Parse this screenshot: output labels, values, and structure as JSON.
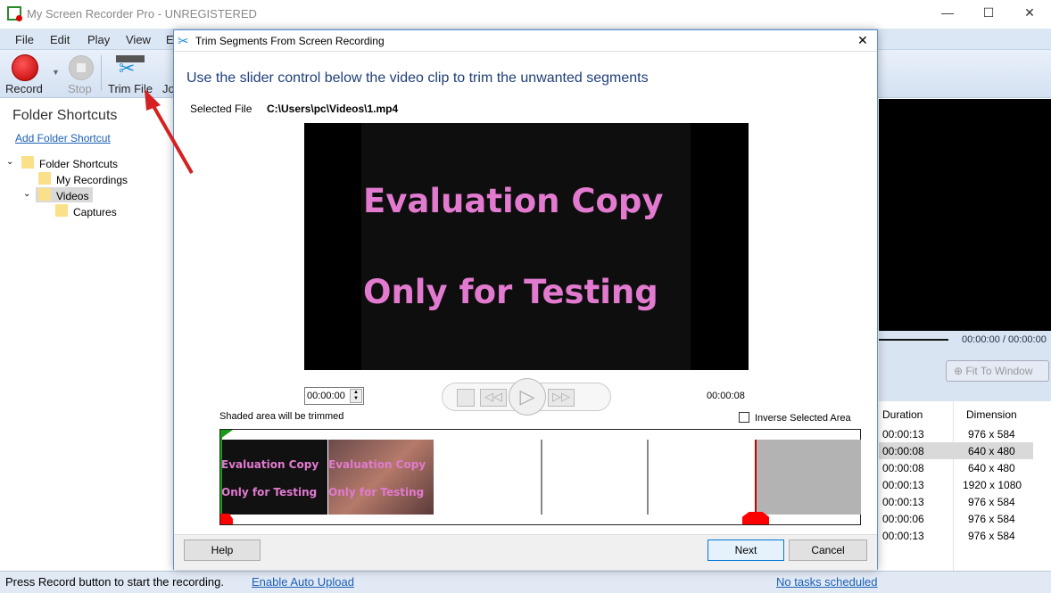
{
  "app": {
    "title": "My Screen Recorder Pro - UNREGISTERED",
    "menu": [
      "File",
      "Edit",
      "Play",
      "View",
      "E"
    ],
    "toolbar": {
      "record": "Record",
      "stop": "Stop",
      "trim": "Trim File",
      "join": "Jo"
    }
  },
  "left": {
    "heading": "Folder Shortcuts",
    "add_link": "Add Folder Shortcut",
    "tree": [
      "Folder Shortcuts",
      "My Recordings",
      "Videos",
      "Captures"
    ]
  },
  "right": {
    "time": "00:00:00 / 00:00:00",
    "fit": "Fit To Window",
    "columns": [
      "Duration",
      "Dimension"
    ],
    "rows": [
      [
        "00:00:13",
        "976 x 584"
      ],
      [
        "00:00:08",
        "640 x 480"
      ],
      [
        "00:00:08",
        "640 x 480"
      ],
      [
        "00:00:13",
        "1920 x 1080"
      ],
      [
        "00:00:13",
        "976 x 584"
      ],
      [
        "00:00:06",
        "976 x 584"
      ],
      [
        "00:00:13",
        "976 x 584"
      ]
    ],
    "selected_row": 1
  },
  "status": {
    "text": "Press Record button to start the recording.",
    "upload": "Enable Auto Upload",
    "tasks": "No tasks scheduled"
  },
  "dialog": {
    "title": "Trim Segments From Screen Recording",
    "instruction": "Use the slider control below the video clip to trim the unwanted segments",
    "file_label": "Selected File",
    "file_path": "C:\\Users\\pc\\Videos\\1.mp4",
    "video_line1": "Evaluation Copy",
    "video_line2": "Only for Testing",
    "start_time": "00:00:00",
    "end_time": "00:00:08",
    "shaded_note": "Shaded area will be trimmed",
    "inverse_label": "Inverse Selected Area",
    "inverse_checked": false,
    "help": "Help",
    "next": "Next",
    "cancel": "Cancel"
  },
  "colors": {
    "accent": "#1a5fb4",
    "watermark_text": "#e27ad0",
    "trim_shade": "#b3b3b3",
    "marker_red": "#ff0000",
    "marker_green": "#1a9a1a"
  }
}
